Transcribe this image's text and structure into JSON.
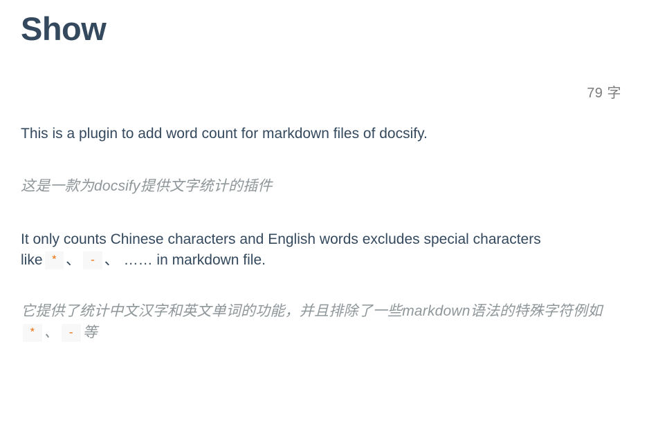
{
  "header": {
    "title": "Show",
    "word_count": "79 字"
  },
  "content": {
    "paragraphs": [
      {
        "name": "paragraph-intro-en",
        "lang": "en",
        "text": "This is a plugin to add word count for markdown files of docsify."
      },
      {
        "name": "paragraph-intro-zh",
        "lang": "zh",
        "text": "这是一款为docsify提供文字统计的插件"
      },
      {
        "name": "paragraph-detail-en",
        "lang": "en",
        "text_before": "It only counts Chinese characters and English words excludes special characters like",
        "code_1": "*",
        "sep_1": "、",
        "code_2": "-",
        "sep_2": "、",
        "ellipsis": "……",
        "text_after": "in markdown file."
      },
      {
        "name": "paragraph-detail-zh",
        "lang": "zh",
        "text_before": "它提供了统计中文汉字和英文单词的功能，并且排除了一些markdown语法的特殊字符例如",
        "code_1": "*",
        "sep_1": "、",
        "code_2": "-",
        "text_after": "等"
      }
    ]
  },
  "colors": {
    "title": "#34495e",
    "body_text": "#34495e",
    "muted_text": "#8f9699",
    "code_text": "#e96900",
    "code_bg": "#f8f8f8",
    "background": "#ffffff"
  }
}
